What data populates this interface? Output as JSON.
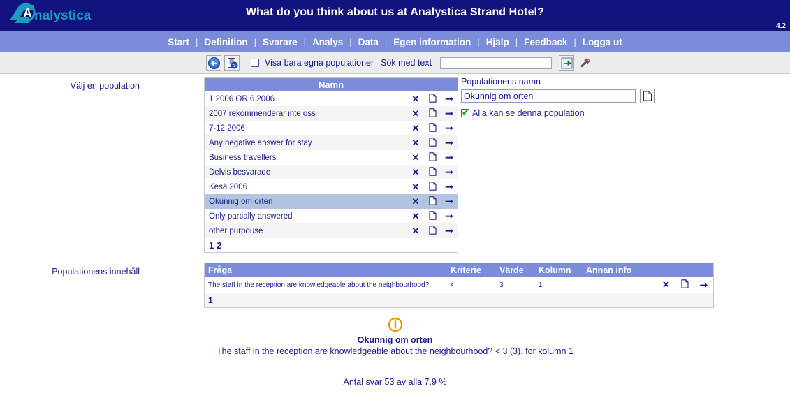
{
  "header": {
    "title": "What do you think about us at Analystica Strand Hotel?",
    "version": "4.2",
    "logo_text": "nalystica",
    "colors": {
      "banner_bg": "#13137f",
      "nav_bg": "#7b8cdb",
      "logo_teal": "#1b9bbf",
      "text_blue": "#1a1a8c",
      "row_selected": "#b2c4e0",
      "info_orange": "#ef8f00"
    }
  },
  "nav": {
    "separator": "|",
    "items": [
      {
        "label": "Start"
      },
      {
        "label": "Definition"
      },
      {
        "label": "Svarare"
      },
      {
        "label": "Analys"
      },
      {
        "label": "Data"
      },
      {
        "label": "Egen information"
      },
      {
        "label": "Hjälp"
      },
      {
        "label": "Feedback"
      },
      {
        "label": "Logga ut"
      }
    ]
  },
  "toolbar": {
    "back_icon": "back-arrow-icon",
    "help_icon": "document-help-icon",
    "checkbox_label": "Visa bara egna populationer",
    "checkbox_checked": false,
    "search_label": "Sök med text",
    "search_value": "",
    "search_placeholder": "",
    "go_icon": "green-arrow-go-icon",
    "tools_icon": "tools-icon"
  },
  "labels": {
    "choose_population": "Välj en population",
    "population_content": "Populationens innehåll"
  },
  "population_table": {
    "column_header": "Namn",
    "rows": [
      {
        "name": "1.2006 OR 6.2006",
        "selected": false
      },
      {
        "name": "2007 rekommenderar inte oss",
        "selected": false
      },
      {
        "name": "7-12.2006",
        "selected": false
      },
      {
        "name": "Any negative answer for stay",
        "selected": false
      },
      {
        "name": "Business travellers",
        "selected": false
      },
      {
        "name": "Delvis besvarade",
        "selected": false
      },
      {
        "name": "Kesä 2006",
        "selected": false
      },
      {
        "name": "Okunnig om orten",
        "selected": true
      },
      {
        "name": "Only partially answered",
        "selected": false
      },
      {
        "name": "other purpouse",
        "selected": false
      }
    ],
    "pages": [
      "1",
      "2"
    ],
    "current_page": "1"
  },
  "name_panel": {
    "caption": "Populationens namn",
    "name_value": "Okunnig om orten",
    "new_doc_icon": "new-document-icon",
    "share_checkbox_label": "Alla kan se denna population",
    "share_checkbox_checked": true,
    "checkmark": "✔"
  },
  "content_table": {
    "columns": [
      "Fråga",
      "Kriterie",
      "Värde",
      "Kolumn",
      "Annan info"
    ],
    "rows": [
      {
        "fraga": "The staff in the reception are knowledgeable about the neighbourhood?",
        "kriterie": "<",
        "varde": "3",
        "kolumn": "1",
        "annan_info": ""
      }
    ],
    "pages": [
      "1"
    ],
    "current_page": "1"
  },
  "footer": {
    "info_icon": "info-icon",
    "title": "Okunnig om orten",
    "description": "The staff in the reception are knowledgeable about the neighbourhood? < 3 (3), för kolumn 1",
    "count_text": "Antal svar 53 av alla 7.9 %"
  }
}
